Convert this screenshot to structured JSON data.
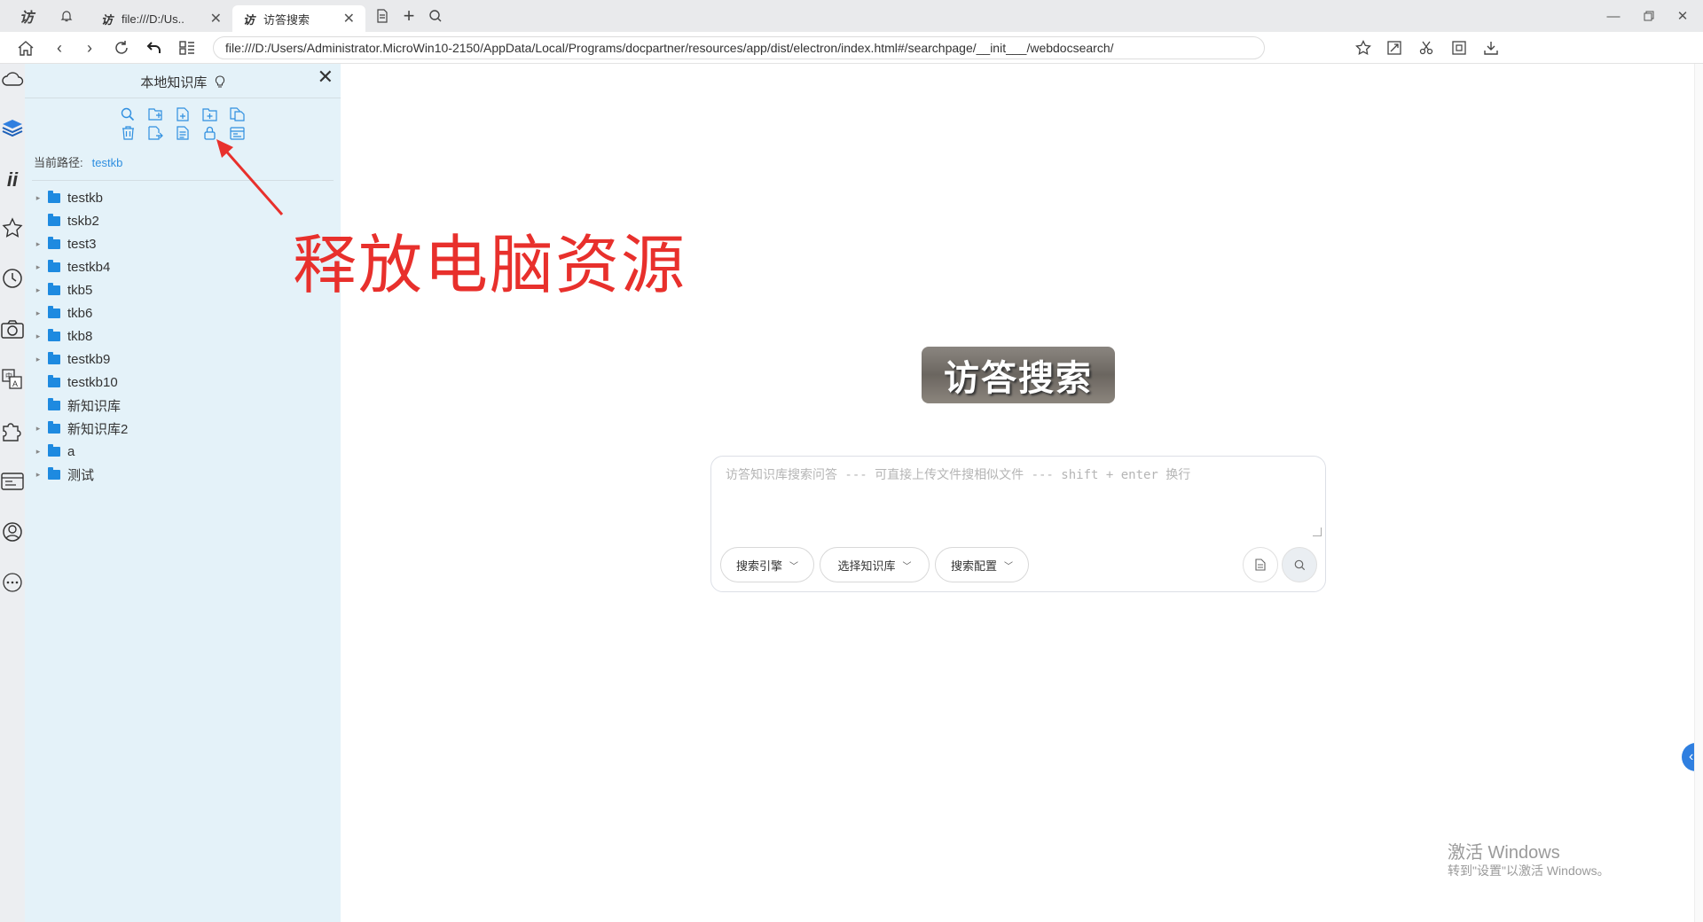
{
  "tabs": [
    {
      "logo": "访",
      "label": "file:///D:/Us..",
      "close": "✕"
    },
    {
      "logo": "访",
      "label": "访答搜索",
      "close": "✕"
    }
  ],
  "address": {
    "url": "file:///D:/Users/Administrator.MicroWin10-2150/AppData/Local/Programs/docpartner/resources/app/dist/electron/index.html#/searchpage/__init___/webdocsearch/"
  },
  "panel": {
    "title": "本地知识库",
    "path_label": "当前路径:",
    "path_value": "testkb",
    "tree": [
      {
        "label": "testkb",
        "expandable": true
      },
      {
        "label": "tskb2",
        "expandable": false
      },
      {
        "label": "test3",
        "expandable": true
      },
      {
        "label": "testkb4",
        "expandable": true
      },
      {
        "label": "tkb5",
        "expandable": true
      },
      {
        "label": "tkb6",
        "expandable": true
      },
      {
        "label": "tkb8",
        "expandable": true
      },
      {
        "label": "testkb9",
        "expandable": true
      },
      {
        "label": "testkb10",
        "expandable": false
      },
      {
        "label": "新知识库",
        "expandable": false
      },
      {
        "label": "新知识库2",
        "expandable": true
      },
      {
        "label": "a",
        "expandable": true
      },
      {
        "label": "测试",
        "expandable": true
      }
    ]
  },
  "annotation": {
    "text": "释放电脑资源",
    "color": "#e8302c"
  },
  "main": {
    "logo_text": "访答搜索",
    "search_placeholder": "访答知识库搜索问答 --- 可直接上传文件搜相似文件 --- shift + enter 换行",
    "buttons": [
      "搜索引擎",
      "选择知识库",
      "搜索配置"
    ]
  },
  "watermark": {
    "title": "激活 Windows",
    "subtitle": "转到\"设置\"以激活 Windows。"
  },
  "colors": {
    "accent": "#2f8fe0",
    "panel_bg": "#e4f2f9"
  }
}
